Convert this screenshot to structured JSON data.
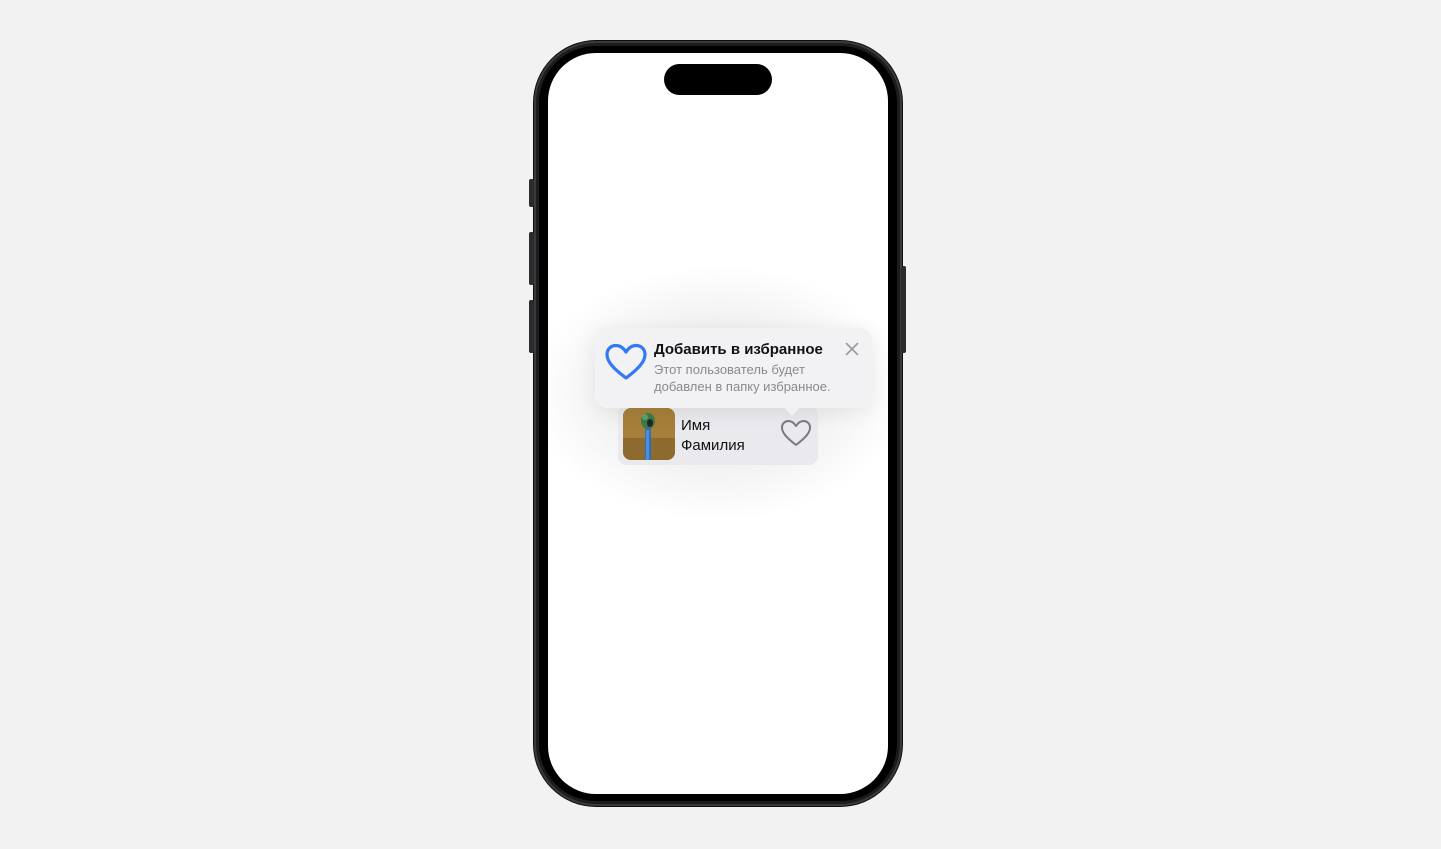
{
  "tooltip": {
    "title": "Добавить в избранное",
    "description": "Этот пользователь будет добавлен в папку избранное.",
    "icon": "heart-icon",
    "close_icon": "close-icon"
  },
  "contact": {
    "name": "Имя\nФамилия",
    "favorite_icon": "heart-outline-icon"
  },
  "colors": {
    "accent": "#3478f6",
    "background": "#f2f2f2",
    "card": "#e9e9ee",
    "tooltip": "#f2f2f5",
    "secondary_text": "#8a8a8e"
  }
}
